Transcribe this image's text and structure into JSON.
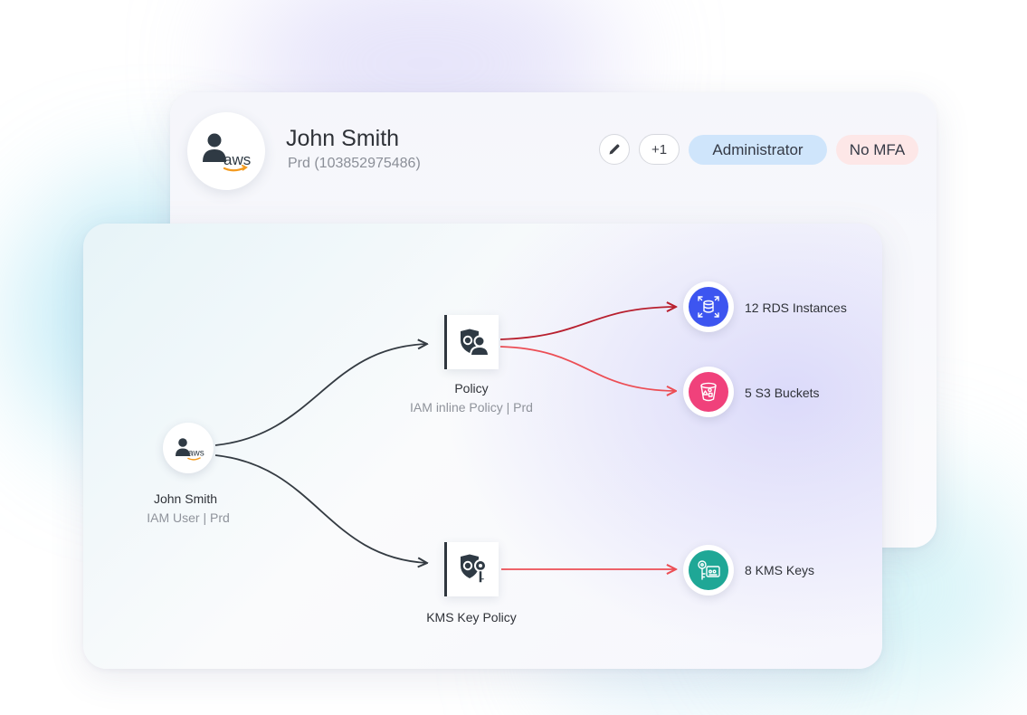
{
  "profile": {
    "name": "John Smith",
    "account": "Prd (103852975486)",
    "avatar_icon": "aws-user-icon",
    "avatar_logo_text": "aws",
    "extra_count": "+1",
    "role_badge": "Administrator",
    "mfa_badge": "No MFA"
  },
  "graph": {
    "user": {
      "name": "John Smith",
      "subtitle": "IAM User | Prd",
      "logo_text": "aws",
      "icon": "aws-user-icon"
    },
    "policy": {
      "name": "Policy",
      "subtitle": "IAM inline Policy | Prd",
      "icon": "policy-user-icon"
    },
    "kms_policy": {
      "name": "KMS Key Policy",
      "icon": "policy-key-icon"
    },
    "resources": {
      "rds": {
        "label": "12 RDS Instances",
        "icon": "rds-database-icon",
        "color": "#3d55f0"
      },
      "s3": {
        "label": "5 S3 Buckets",
        "icon": "s3-bucket-icon",
        "color": "#f0417b"
      },
      "kms": {
        "label": "8 KMS Keys",
        "icon": "kms-key-icon",
        "color": "#1fa796"
      }
    }
  },
  "colors": {
    "edge_dark": "#343b42",
    "edge_red_dark": "#b8202f",
    "edge_red": "#ec4e55",
    "admin_badge_bg": "#cfe5fb",
    "mfa_badge_bg": "#fde7e7"
  }
}
